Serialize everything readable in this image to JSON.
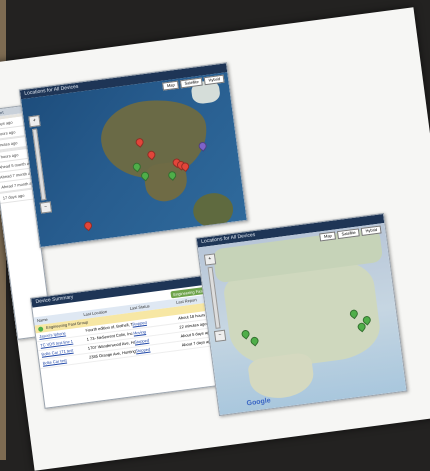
{
  "page": {
    "background": "#232221",
    "accent_strip": "#7d6b52"
  },
  "locations_map_small": {
    "title": "Locations for All Devices",
    "buttons": [
      "Map",
      "Satellite",
      "Hybrid"
    ],
    "zoom_icons": [
      "zoom-in-icon",
      "zoom-out-icon"
    ],
    "pins": [
      {
        "color": "#e2453a"
      },
      {
        "color": "#e2453a"
      },
      {
        "color": "#e2453a"
      },
      {
        "color": "#e2453a"
      },
      {
        "color": "#e2453a"
      },
      {
        "color": "#4fae49"
      },
      {
        "color": "#4fae49"
      },
      {
        "color": "#4fae49"
      },
      {
        "color": "#7d63c9"
      },
      {
        "color": "#e2453a"
      }
    ]
  },
  "left_list": {
    "header": "Report",
    "rows": [
      "",
      "",
      "",
      "3 days ago",
      "8 hours ago",
      "",
      "minutes ago",
      "",
      "",
      "9 hours ago",
      "Ahead 5 month ago",
      "Ahead 7 month ago",
      "Ahead 7 month ago",
      "",
      "17 days ago"
    ]
  },
  "device_summary": {
    "title": "Device Summary",
    "action_button": "Engineering Fast Group",
    "columns": [
      "Name",
      "Last Location",
      "Last Status",
      "Last Report"
    ],
    "group_label": "Engineering Fast Group",
    "rows": [
      [
        "Jason's Iphone",
        "Fourth edition of, Bothell, Tx",
        "Stopped",
        "About 18 hours ago"
      ],
      [
        "TC VDS test line 1",
        "1 73- NeSerrent Colin, Inc",
        "Moving",
        "22 minutes ago"
      ],
      [
        "Bolte Car 171 test",
        "1707 Wanderwood Ave, Ho Rockville, CA",
        "Stopped",
        "About 5 days ago"
      ],
      [
        "Bolte Car test",
        "2385 Orange Ave, Huntington Beach CA",
        "Stopped",
        "About 7 days ago"
      ]
    ]
  },
  "locations_map_large": {
    "title": "Locations for All Devices",
    "buttons": [
      "Map",
      "Satellite",
      "Hybrid"
    ],
    "logo": "Google",
    "pins": [
      {
        "color": "#4fae49"
      },
      {
        "color": "#4fae49"
      },
      {
        "color": "#4fae49"
      },
      {
        "color": "#4fae49"
      },
      {
        "color": "#4fae49"
      }
    ]
  }
}
